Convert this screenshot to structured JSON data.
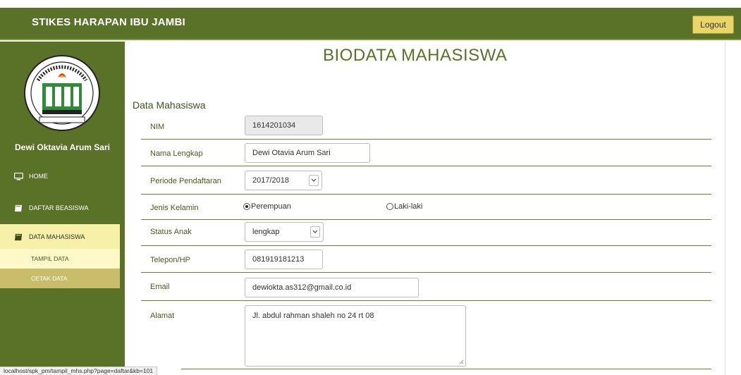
{
  "header": {
    "brand": "STIKES HARAPAN IBU JAMBI",
    "logout_label": "Logout"
  },
  "sidebar": {
    "logo_icon": "school-seal-logo",
    "user_name": "Dewi Oktavia Arum Sari",
    "items": [
      {
        "label": "HOME",
        "icon": "monitor-icon"
      },
      {
        "label": "DAFTAR BEASISWA",
        "icon": "book-icon"
      },
      {
        "label": "DATA MAHASISWA",
        "icon": "book-icon",
        "active": true
      }
    ],
    "sub_items": [
      {
        "label": "TAMPIL DATA"
      },
      {
        "label": "CETAK DATA"
      }
    ]
  },
  "main": {
    "title": "BIODATA MAHASISWA",
    "section_title": "Data Mahasiswa",
    "fields": {
      "nim": {
        "label": "NIM",
        "value": "1614201034"
      },
      "nama": {
        "label": "Nama Lengkap",
        "value": "Dewi Otavia Arum Sari"
      },
      "periode": {
        "label": "Periode Pendaftaran",
        "value": "2017/2018"
      },
      "jenis_kelamin": {
        "label": "Jenis Kelamin",
        "options": [
          "Perempuan",
          "Laki-laki"
        ],
        "selected": "Perempuan"
      },
      "status_anak": {
        "label": "Status Anak",
        "value": "lengkap"
      },
      "telepon": {
        "label": "Telepon/HP",
        "value": "081919181213"
      },
      "email": {
        "label": "Email",
        "value": "dewiokta.as312@gmail.co.id"
      },
      "alamat": {
        "label": "Alamat",
        "value": "Jl. abdul rahman shaleh no 24 rt 08"
      }
    }
  },
  "status_bar": {
    "url": "localhost/spk_pm/tampil_mhs.php?page=daftar&kb=101"
  },
  "colors": {
    "primary_green": "#5a7128",
    "logout_yellow": "#ead668",
    "active_nav": "#f6f0a8",
    "sub_active": "#fff9c8",
    "sub_inactive": "#c9bc6b"
  }
}
